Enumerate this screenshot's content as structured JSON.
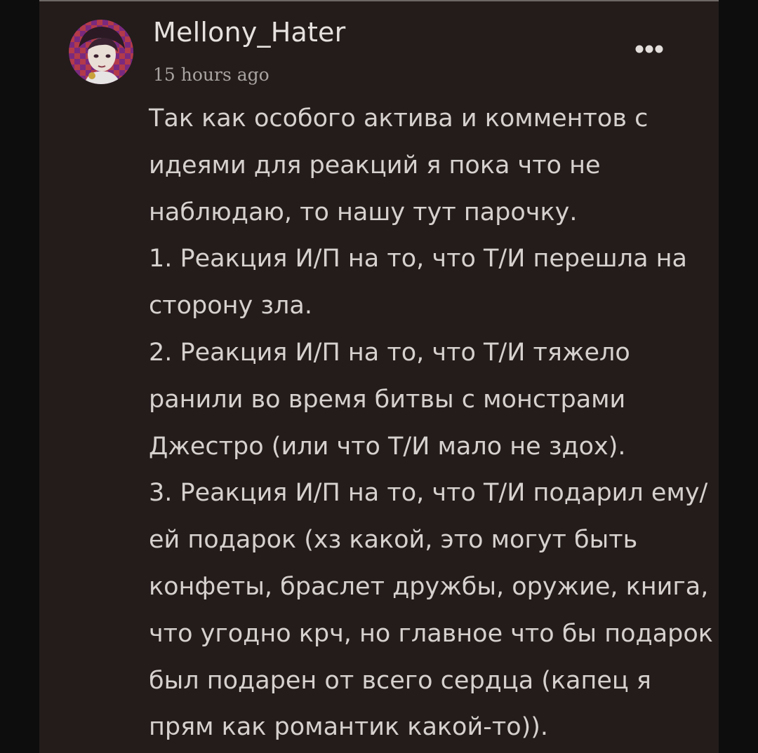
{
  "comment": {
    "username": "Mellony_Hater",
    "timestamp": "15 hours ago",
    "text_lines": [
      " Так как особого актива и комментов с",
      "идеями для реакций я пока что не",
      "наблюдаю, то нашу тут парочку.",
      "1. Реакция И/П на то, что Т/И перешла на",
      "сторону зла.",
      "2. Реакция И/П на то, что Т/И тяжело",
      "ранили во время битвы с монстрами",
      "Джестро (или что Т/И мало не здох).",
      "3. Реакция И/П на то, что Т/И подарил ему/",
      "ей подарок (хз какой, это могут быть",
      "конфеты, браслет дружбы, оружие, книга,",
      "что угодно крч, но главное что бы подарок",
      "был подарен от всего сердца (капец я",
      "прям как романтик какой-то))."
    ]
  },
  "icons": {
    "avatar": "user-avatar-image",
    "more": "more-options-icon"
  },
  "colors": {
    "background": "#0d0d0d",
    "card": "#231c1b",
    "username": "#e6e1df",
    "timestamp": "#a9a3a1",
    "text": "#d6d0ce"
  }
}
